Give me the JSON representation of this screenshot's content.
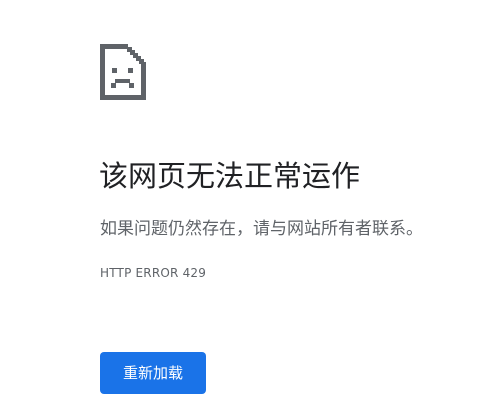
{
  "icon": "sad-page-icon",
  "title": "该网页无法正常运作",
  "message": "如果问题仍然存在，请与网站所有者联系。",
  "error_code": "HTTP ERROR 429",
  "reload_label": "重新加载",
  "colors": {
    "title": "#202124",
    "body_text": "#5f6368",
    "icon": "#5f6368",
    "button": "#1a73e8",
    "button_text": "#ffffff"
  }
}
